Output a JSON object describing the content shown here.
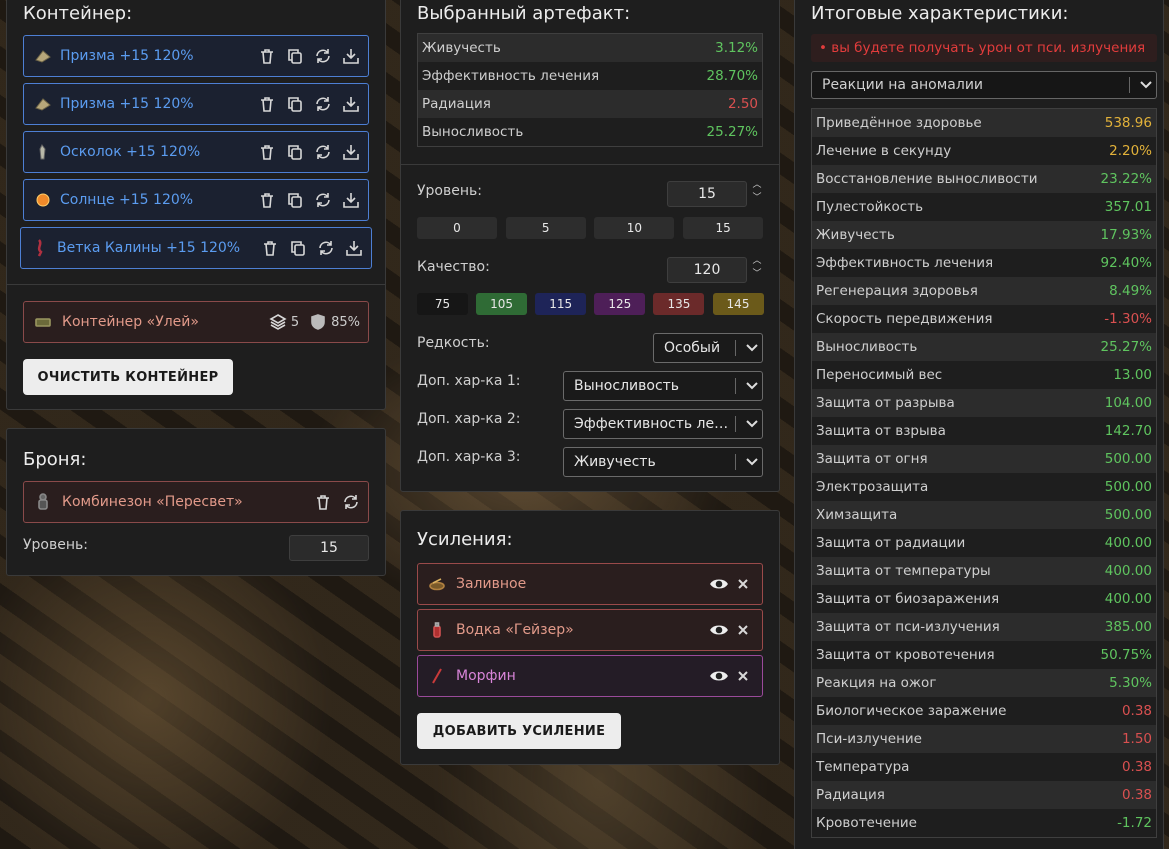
{
  "container": {
    "title": "Контейнер:",
    "slots": [
      {
        "name": "Призма +15 120%",
        "icon": "prism-icon"
      },
      {
        "name": "Призма +15 120%",
        "icon": "prism-icon"
      },
      {
        "name": "Осколок +15 120%",
        "icon": "shard-icon"
      },
      {
        "name": "Солнце +15 120%",
        "icon": "sun-icon"
      },
      {
        "name": "Ветка Калины +15 120%",
        "icon": "viburnum-branch-icon"
      }
    ],
    "item": {
      "name": "Контейнер «Улей»",
      "capacity": "5",
      "protection": "85%"
    },
    "clear_label": "ОЧИСТИТЬ КОНТЕЙНЕР"
  },
  "armor": {
    "title": "Броня:",
    "name": "Комбинезон «Пересвет»",
    "level_label": "Уровень:",
    "level": "15"
  },
  "artifact": {
    "title": "Выбранный артефакт:",
    "stats": [
      {
        "name": "Живучесть",
        "value": "3.12%",
        "color": "g"
      },
      {
        "name": "Эффективность лечения",
        "value": "28.70%",
        "color": "g"
      },
      {
        "name": "Радиация",
        "value": "2.50",
        "color": "r"
      },
      {
        "name": "Выносливость",
        "value": "25.27%",
        "color": "g"
      }
    ],
    "level_label": "Уровень:",
    "level": "15",
    "level_presets": [
      "0",
      "5",
      "10",
      "15"
    ],
    "quality_label": "Качество:",
    "quality": "120",
    "quality_presets": [
      {
        "label": "75",
        "color": "#161616"
      },
      {
        "label": "105",
        "color": "#2f6b35"
      },
      {
        "label": "115",
        "color": "#1e2458"
      },
      {
        "label": "125",
        "color": "#4e1f58"
      },
      {
        "label": "135",
        "color": "#6b2a2a"
      },
      {
        "label": "145",
        "color": "#6b5a1a"
      }
    ],
    "rarity_label": "Редкость:",
    "rarity": "Особый",
    "extra1_label": "Доп. хар-ка 1:",
    "extra1": "Выносливость",
    "extra2_label": "Доп. хар-ка 2:",
    "extra2": "Эффективность лечения",
    "extra3_label": "Доп. хар-ка 3:",
    "extra3": "Живучесть"
  },
  "boosts": {
    "title": "Усиления:",
    "items": [
      {
        "name": "Заливное",
        "icon": "aspic-icon"
      },
      {
        "name": "Водка «Гейзер»",
        "icon": "vodka-icon"
      },
      {
        "name": "Морфин",
        "icon": "syringe-icon"
      }
    ],
    "add_label": "ДОБАВИТЬ УСИЛЕНИЕ"
  },
  "totals": {
    "title": "Итоговые характеристики:",
    "warning": "• вы будете получать урон от пси. излучения",
    "filter": "Реакции на аномалии",
    "stats": [
      {
        "name": "Приведённое здоровье",
        "value": "538.96",
        "color": "y"
      },
      {
        "name": "Лечение в секунду",
        "value": "2.20%",
        "color": "y"
      },
      {
        "name": "Восстановление выносливости",
        "value": "23.22%",
        "color": "g"
      },
      {
        "name": "Пулестойкость",
        "value": "357.01",
        "color": "g"
      },
      {
        "name": "Живучесть",
        "value": "17.93%",
        "color": "g"
      },
      {
        "name": "Эффективность лечения",
        "value": "92.40%",
        "color": "g"
      },
      {
        "name": "Регенерация здоровья",
        "value": "8.49%",
        "color": "g"
      },
      {
        "name": "Скорость передвижения",
        "value": "-1.30%",
        "color": "r"
      },
      {
        "name": "Выносливость",
        "value": "25.27%",
        "color": "g"
      },
      {
        "name": "Переносимый вес",
        "value": "13.00",
        "color": "g"
      },
      {
        "name": "Защита от разрыва",
        "value": "104.00",
        "color": "g"
      },
      {
        "name": "Защита от взрыва",
        "value": "142.70",
        "color": "g"
      },
      {
        "name": "Защита от огня",
        "value": "500.00",
        "color": "g"
      },
      {
        "name": "Электрозащита",
        "value": "500.00",
        "color": "g"
      },
      {
        "name": "Химзащита",
        "value": "500.00",
        "color": "g"
      },
      {
        "name": "Защита от радиации",
        "value": "400.00",
        "color": "g"
      },
      {
        "name": "Защита от температуры",
        "value": "400.00",
        "color": "g"
      },
      {
        "name": "Защита от биозаражения",
        "value": "400.00",
        "color": "g"
      },
      {
        "name": "Защита от пси-излучения",
        "value": "385.00",
        "color": "g"
      },
      {
        "name": "Защита от кровотечения",
        "value": "50.75%",
        "color": "g"
      },
      {
        "name": "Реакция на ожог",
        "value": "5.30%",
        "color": "g"
      },
      {
        "name": "Биологическое заражение",
        "value": "0.38",
        "color": "r"
      },
      {
        "name": "Пси-излучение",
        "value": "1.50",
        "color": "r"
      },
      {
        "name": "Температура",
        "value": "0.38",
        "color": "r"
      },
      {
        "name": "Радиация",
        "value": "0.38",
        "color": "r"
      },
      {
        "name": "Кровотечение",
        "value": "-1.72",
        "color": "g"
      }
    ]
  }
}
